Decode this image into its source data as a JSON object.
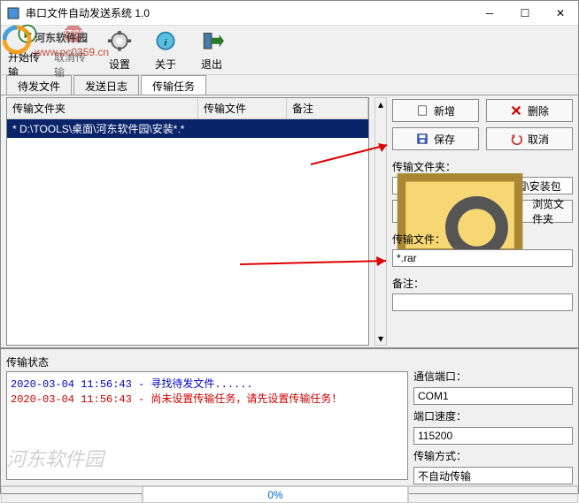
{
  "window": {
    "title": "串口文件自动发送系统 1.0"
  },
  "toolbar": {
    "start": "开始传输",
    "cancel": "取消传输",
    "settings": "设置",
    "about": "关于",
    "exit": "退出"
  },
  "tabs": {
    "pending": "待发文件",
    "log": "发送日志",
    "task": "传输任务"
  },
  "grid": {
    "col1": "传输文件夹",
    "col2": "传输文件",
    "col3": "备注",
    "row1": "* D:\\TOOLS\\桌面\\河东软件园\\安装*.*"
  },
  "buttons": {
    "add": "新增",
    "delete": "删除",
    "save": "保存",
    "cancel": "取消",
    "browse": "浏览文件夹"
  },
  "form": {
    "folder_label": "传输文件夹：",
    "folder_value": "D:\\TOOLS\\桌面\\河东软件园\\安装包",
    "file_label": "传输文件：",
    "file_value": "*.rar",
    "remark_label": "备注：",
    "remark_value": ""
  },
  "status": {
    "label": "传输状态",
    "line1": "2020-03-04 11:56:43 - 寻找待发文件......",
    "line2": "2020-03-04 11:56:43 - 尚未设置传输任务，请先设置传输任务！",
    "port_label": "通信端口：",
    "port_value": "COM1",
    "baud_label": "端口速度：",
    "baud_value": "115200",
    "mode_label": "传输方式：",
    "mode_value": "不自动传输"
  },
  "footer": {
    "progress": "0%"
  },
  "watermark": {
    "site": "河东软件园",
    "url": "www.pc0359.cn",
    "bottom": "河东软件园"
  }
}
